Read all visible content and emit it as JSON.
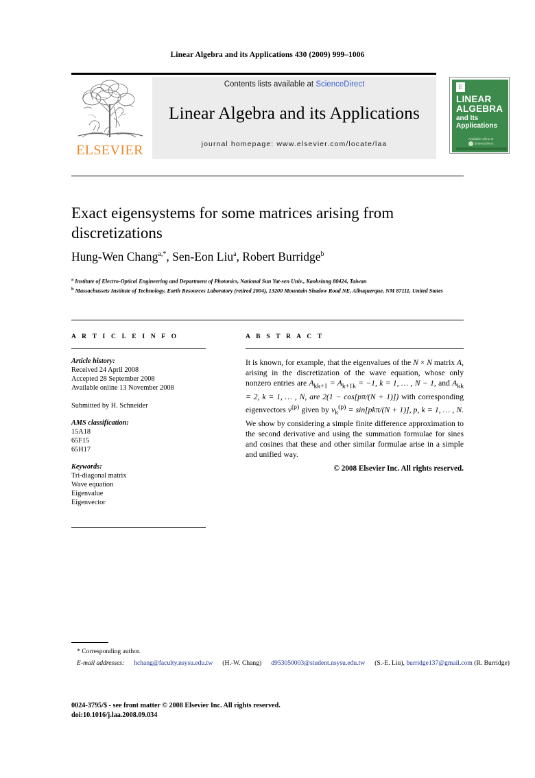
{
  "running_head": "Linear Algebra and its Applications 430 (2009) 999–1006",
  "masthead": {
    "contents_prefix": "Contents lists available at ",
    "sciencedirect": "ScienceDirect",
    "journal_title": "Linear Algebra and its Applications",
    "homepage": "journal homepage: www.elsevier.com/locate/laa",
    "publisher": "ELSEVIER",
    "publisher_color": "#F08522",
    "band_color": "#ececec",
    "link_color": "#3a5fcd"
  },
  "cover": {
    "line1": "LINEAR",
    "line2": "ALGEBRA",
    "line3": "and Its",
    "line4": "Applications",
    "elsevier_mark": "E",
    "sciencedirect_caption": "Available online at",
    "sciencedirect_name": "ScienceDirect",
    "background_color": "#3d8b4c"
  },
  "article": {
    "title": "Exact eigensystems for some matrices arising from discretizations",
    "authors": [
      {
        "name": "Hung-Wen Chang",
        "marks": "a,*"
      },
      {
        "name": "Sen-Eon Liu",
        "marks": "a"
      },
      {
        "name": "Robert Burridge",
        "marks": "b"
      }
    ],
    "affiliations": [
      {
        "mark": "a",
        "text": "Institute of Electro-Optical Engineering and Department of Photonics, National Sun Yat-sen Univ., Kaohsiung 80424, Taiwan"
      },
      {
        "mark": "b",
        "text": "Massachussets Institute of Technology, Earth Resources Laboratory (retired 2004), 13200 Mountain Shadow Road NE, Albuquerque, NM 87111, United States"
      }
    ]
  },
  "info": {
    "heading": "A R T I C L E    I N F O",
    "history_label": "Article history:",
    "history": [
      "Received 24 April 2008",
      "Accepted 28 September 2008",
      "Available online 13 November 2008"
    ],
    "submitted_by": "Submitted by H. Schneider",
    "ams_label": "AMS classification:",
    "ams_codes": [
      "15A18",
      "65F15",
      "65H17"
    ],
    "keywords_label": "Keywords:",
    "keywords": [
      "Tri-diagonal matrix",
      "Wave equation",
      "Eigenvalue",
      "Eigenvector"
    ]
  },
  "abstract": {
    "heading": "A B S T R A C T",
    "p1_a": "It is known, for example, that the eigenvalues of the ",
    "p1_N1": "N",
    "p1_times": " × ",
    "p1_N2": "N",
    "p1_b": " matrix ",
    "p1_A": "A",
    "p1_c": ", arising in the discretization of the wave equation, whose only nonzero entries are ",
    "eq1": "A",
    "eq1_sub": "kk+1",
    "eq1_rest": " = A",
    "eq1_sub2": "k+1k",
    "eq1_tail": " = −1, k = 1, … , N − 1,",
    "p1_d": " and ",
    "eq2": "A",
    "eq2_sub": "kk",
    "eq2_tail": " = 2, k = 1, … , N, are 2(1 − cos[pπ/(N + 1)])",
    "p1_e": " with corresponding eigenvectors ",
    "eq3": "v",
    "eq3_sup": "(p)",
    "p1_f": " given by ",
    "eq4": "v",
    "eq4_sub": "k",
    "eq4_sup": "(p)",
    "eq4_tail": " = sin[pkπ/(N + 1)], p, k = 1, … , N.",
    "p2": "We show by considering a simple finite difference approximation to the second derivative and using the summation formulae for sines and cosines that these and other similar formulae arise in a simple and unified way.",
    "copyright": "© 2008 Elsevier Inc. All rights reserved."
  },
  "footnotes": {
    "corresponding": "* Corresponding author.",
    "email_label": "E-mail addresses:",
    "emails": [
      {
        "address": "hchang@faculty.nsysu.edu.tw",
        "owner": "(H.-W. Chang)"
      },
      {
        "address": "d953050003@student.nsysu.edu.tw",
        "owner": "(S.-E. Liu)"
      },
      {
        "address": "burridge137@gmail.com",
        "owner": "(R. Burridge)"
      }
    ],
    "email_color": "#1b2f8f"
  },
  "imprint": {
    "line1": "0024-3795/$ - see front matter © 2008 Elsevier Inc. All rights reserved.",
    "line2": "doi:10.1016/j.laa.2008.09.034"
  }
}
